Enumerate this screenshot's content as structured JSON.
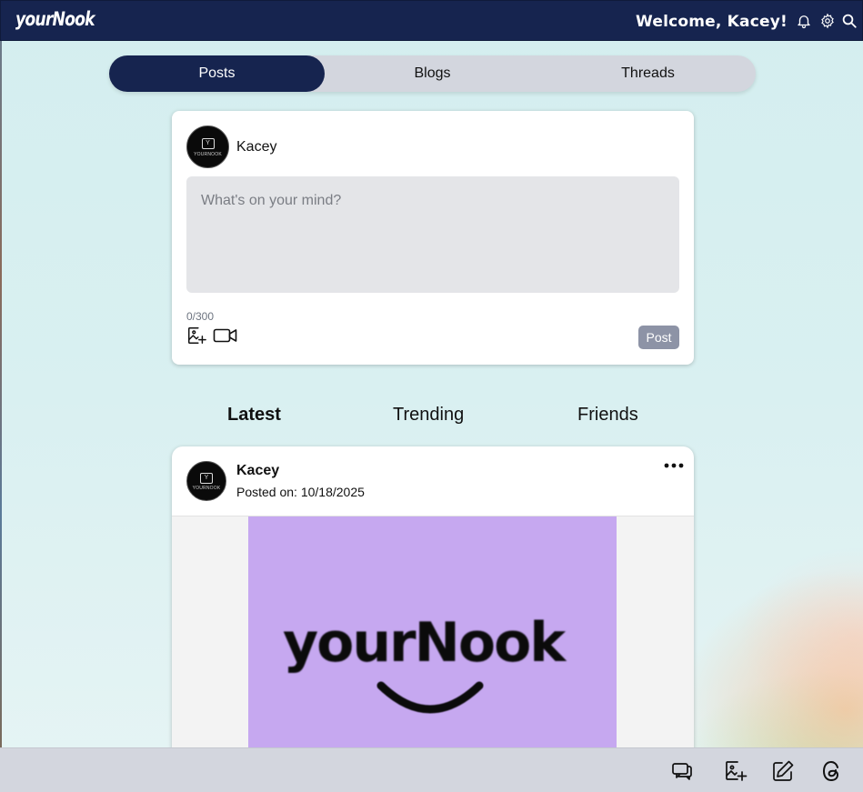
{
  "header": {
    "logo": "yourNook",
    "welcome": "Welcome, Kacey!",
    "icons": [
      "bell-icon",
      "gear-icon",
      "search-icon"
    ]
  },
  "tabs": [
    {
      "label": "Posts",
      "active": true
    },
    {
      "label": "Blogs",
      "active": false
    },
    {
      "label": "Threads",
      "active": false
    }
  ],
  "composer": {
    "avatar_box": "Y",
    "avatar_label": "YOURNOOK",
    "username": "Kacey",
    "placeholder": "What's on your mind?",
    "counter": "0/300",
    "post_label": "Post",
    "icons": [
      "add-image-icon",
      "video-icon"
    ]
  },
  "feed_tabs": [
    {
      "label": "Latest",
      "active": true
    },
    {
      "label": "Trending",
      "active": false
    },
    {
      "label": "Friends",
      "active": false
    }
  ],
  "post": {
    "avatar_box": "Y",
    "avatar_label": "YOURNOOK",
    "author": "Kacey",
    "date": "Posted on: 10/18/2025",
    "image_text": "yourNook"
  },
  "bottom_nav": {
    "icons": [
      "chat-icon",
      "add-image-icon",
      "edit-icon",
      "threads-icon"
    ]
  },
  "colors": {
    "navy": "#16244f",
    "tab_track": "#d3d6de",
    "post_button": "#8d93a6",
    "image_bg": "#c6a8f0"
  }
}
